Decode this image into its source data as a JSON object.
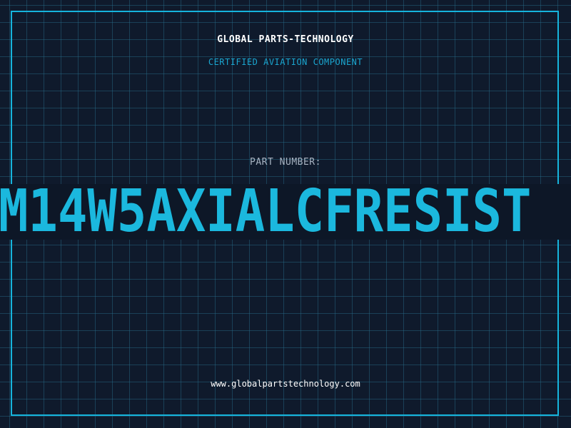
{
  "label": {
    "company": "GLOBAL PARTS-TECHNOLOGY",
    "subtitle": "CERTIFIED AVIATION COMPONENT",
    "part_number_label": "PART NUMBER:",
    "part_number": "M14W5AXIALCFRESIST",
    "website": "www.globalpartstechnology.com"
  },
  "colors": {
    "background": "#0f1a2c",
    "grid": "#286e8c",
    "accent": "#1bb8de",
    "text_primary": "#ffffff",
    "text_muted": "#a8b3c2"
  }
}
